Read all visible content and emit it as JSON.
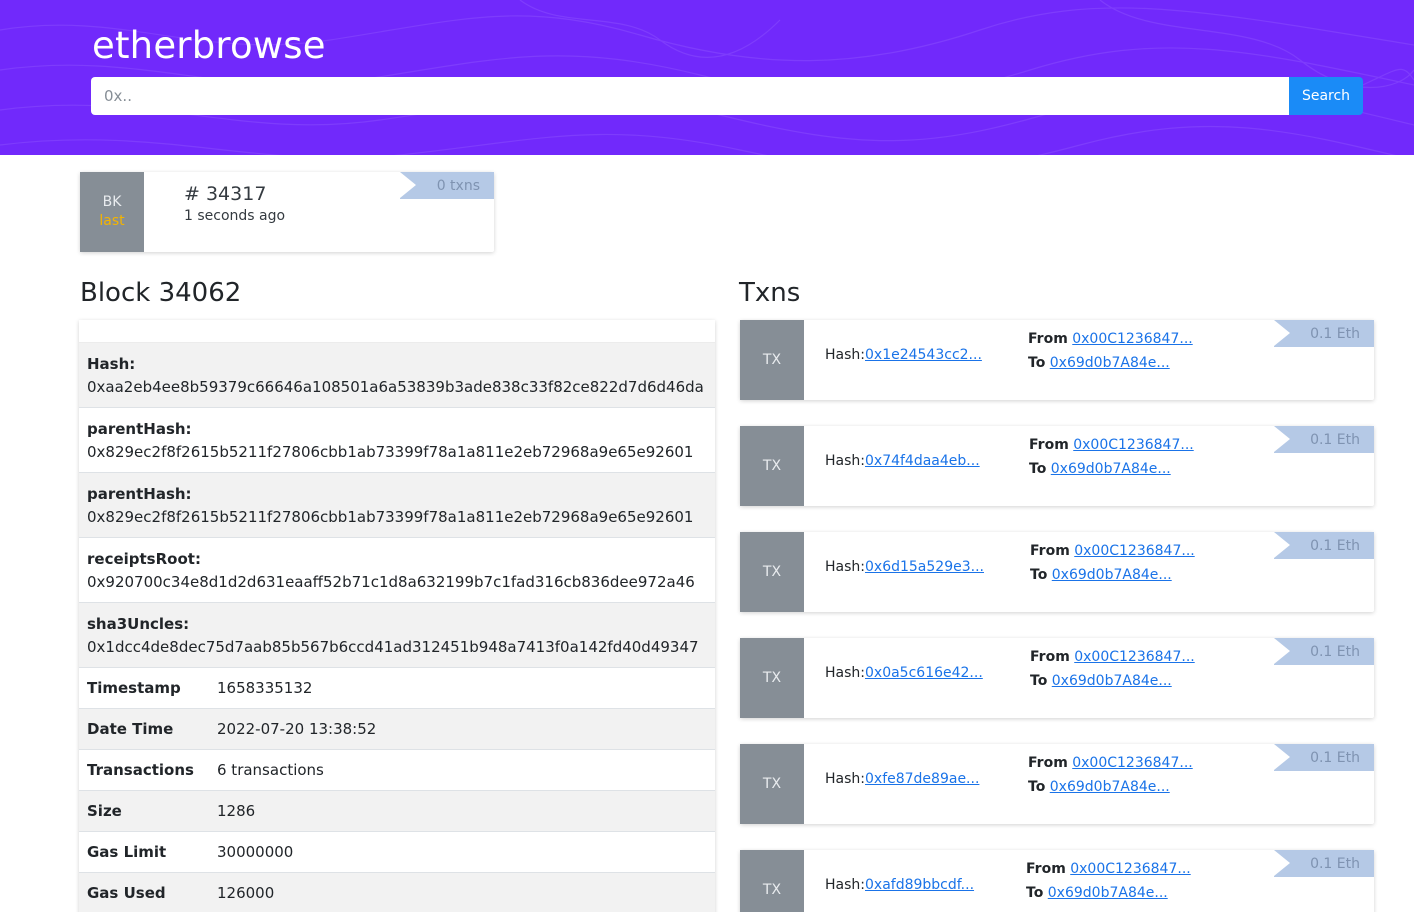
{
  "header": {
    "brand": "etherbrowse",
    "search_placeholder": "0x..",
    "search_button": "Search",
    "background_color": "#7129fb"
  },
  "latest_block": {
    "badge": "BK",
    "badge_sub": "last",
    "number": "# 34317",
    "age": "1 seconds ago",
    "txns": "0 txns"
  },
  "block": {
    "title": "Block 34062",
    "stacked_fields": [
      {
        "key": "Hash:",
        "value": "0xaa2eb4ee8b59379c66646a108501a6a53839b3ade838c33f82ce822d7d6d46da"
      },
      {
        "key": "parentHash:",
        "value": "0x829ec2f8f2615b5211f27806cbb1ab73399f78a1a811e2eb72968a9e65e92601"
      },
      {
        "key": "parentHash:",
        "value": "0x829ec2f8f2615b5211f27806cbb1ab73399f78a1a811e2eb72968a9e65e92601"
      },
      {
        "key": "receiptsRoot:",
        "value": "0x920700c34e8d1d2d631eaaff52b71c1d8a632199b7c1fad316cb836dee972a46"
      },
      {
        "key": "sha3Uncles:",
        "value": "0x1dcc4de8dec75d7aab85b567b6ccd41ad312451b948a7413f0a142fd40d49347"
      }
    ],
    "line_fields": [
      {
        "key": "Timestamp",
        "value": "1658335132"
      },
      {
        "key": "Date Time",
        "value": "2022-07-20 13:38:52"
      },
      {
        "key": "Transactions",
        "value": "6 transactions"
      },
      {
        "key": "Size",
        "value": "1286"
      },
      {
        "key": "Gas Limit",
        "value": "30000000"
      },
      {
        "key": "Gas Used",
        "value": "126000"
      }
    ]
  },
  "txns": {
    "title": "Txns",
    "badge": "TX",
    "hash_label": "Hash:",
    "from_label": "From",
    "to_label": "To",
    "items": [
      {
        "hash": "0x1e24543cc2...",
        "from": "0x00C1236847...",
        "to": "0x69d0b7A84e...",
        "value": "0.1 Eth"
      },
      {
        "hash": "0x74f4daa4eb...",
        "from": "0x00C1236847...",
        "to": "0x69d0b7A84e...",
        "value": "0.1 Eth"
      },
      {
        "hash": "0x6d15a529e3...",
        "from": "0x00C1236847...",
        "to": "0x69d0b7A84e...",
        "value": "0.1 Eth"
      },
      {
        "hash": "0x0a5c616e42...",
        "from": "0x00C1236847...",
        "to": "0x69d0b7A84e...",
        "value": "0.1 Eth"
      },
      {
        "hash": "0xfe87de89ae...",
        "from": "0x00C1236847...",
        "to": "0x69d0b7A84e...",
        "value": "0.1 Eth"
      },
      {
        "hash": "0xafd89bbcdf...",
        "from": "0x00C1236847...",
        "to": "0x69d0b7A84e...",
        "value": "0.1 Eth"
      }
    ]
  }
}
